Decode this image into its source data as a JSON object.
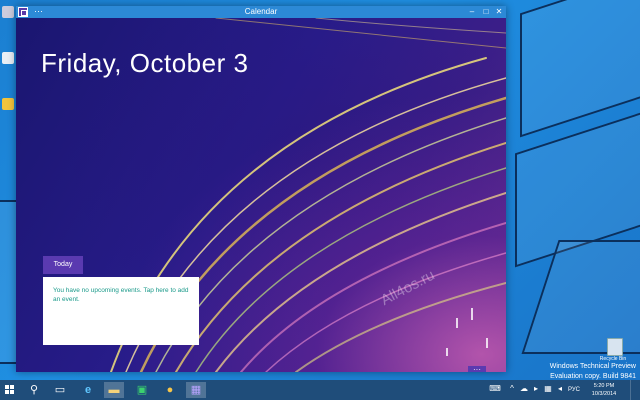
{
  "window": {
    "title": "Calendar",
    "menu_label": "···",
    "minimize_label": "–",
    "maximize_label": "□",
    "close_label": "✕"
  },
  "calendar": {
    "date_heading": "Friday, October 3",
    "today_label": "Today",
    "no_events_text": "You have no upcoming events. Tap here to add an event.",
    "more_label": "···"
  },
  "watermark": "All4os.ru",
  "desktop": {
    "recycle_bin_label": "Recycle Bin"
  },
  "evaluation": {
    "line1": "Windows Technical Preview",
    "line2": "Evaluation copy. Build 9841"
  },
  "tray": {
    "language": "РУС",
    "time": "5:20 PM",
    "date": "10/3/2014"
  },
  "taskbar_icons": [
    "start-icon",
    "search-icon",
    "task-view-icon",
    "internet-explorer-icon",
    "file-explorer-icon",
    "store-icon",
    "games-icon",
    "calendar-app-icon"
  ],
  "colors": {
    "titlebar": "#2c89d6",
    "accent": "#5a3ab0",
    "event_text": "#1a9a8a",
    "taskbar": "#1f4d7a"
  }
}
